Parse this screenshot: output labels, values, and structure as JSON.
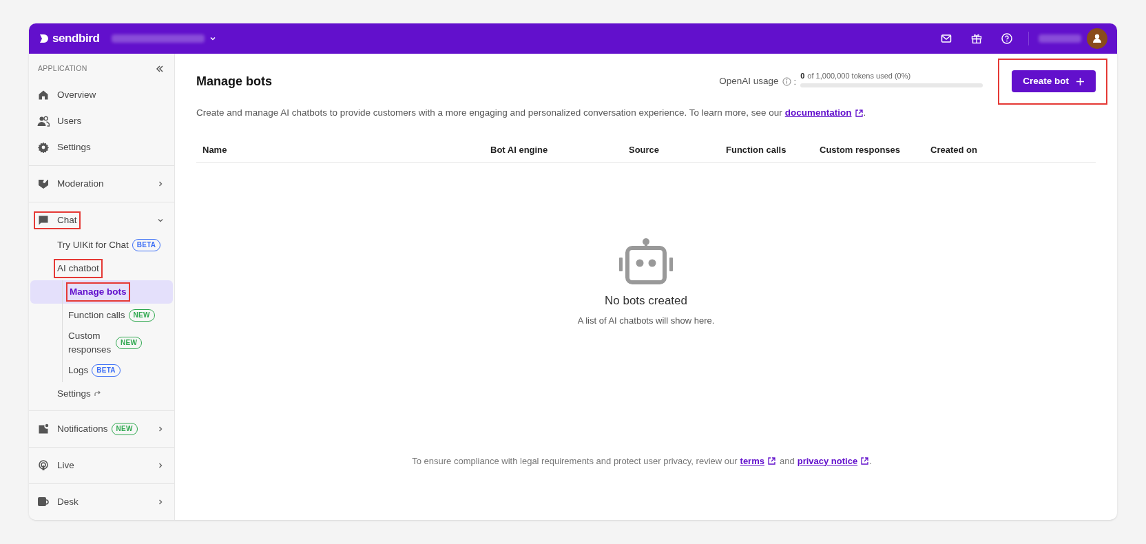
{
  "topbar": {
    "logo": "sendbird"
  },
  "sidebar": {
    "heading": "APPLICATION",
    "groups": [
      [
        {
          "label": "Overview",
          "selected": false,
          "annotated": false
        },
        {
          "label": "Users",
          "selected": false,
          "annotated": false
        },
        {
          "label": "Settings",
          "selected": false,
          "annotated": false
        }
      ],
      [
        {
          "label": "Moderation",
          "selected": false,
          "annotated": false,
          "expanded": false
        }
      ],
      [
        {
          "label": "Chat",
          "selected": false,
          "annotated": true,
          "expanded": true,
          "children": [
            {
              "label": "Try UIKit for Chat",
              "selected": false,
              "annotated": false,
              "badge": {
                "text": "BETA",
                "color": "#3b6ef6"
              }
            },
            {
              "label": "AI chatbot",
              "selected": false,
              "annotated": true,
              "children": [
                {
                  "label": "Manage bots",
                  "selected": true,
                  "annotated": true
                },
                {
                  "label": "Function calls",
                  "selected": false,
                  "annotated": false,
                  "badge": {
                    "text": "NEW",
                    "color": "#2fa84f"
                  }
                },
                {
                  "label": "Custom responses",
                  "selected": false,
                  "annotated": false,
                  "badge": {
                    "text": "NEW",
                    "color": "#2fa84f"
                  }
                },
                {
                  "label": "Logs",
                  "selected": false,
                  "annotated": false,
                  "badge": {
                    "text": "BETA",
                    "color": "#3b6ef6"
                  }
                }
              ]
            },
            {
              "label": "Settings",
              "selected": false,
              "annotated": false,
              "external": true
            }
          ]
        }
      ],
      [
        {
          "label": "Notifications",
          "selected": false,
          "annotated": false,
          "expanded": false,
          "badge": {
            "text": "NEW",
            "color": "#2fa84f"
          }
        }
      ],
      [
        {
          "label": "Live",
          "selected": false,
          "annotated": false,
          "expanded": false
        }
      ],
      [
        {
          "label": "Desk",
          "selected": false,
          "annotated": false,
          "expanded": false
        }
      ]
    ]
  },
  "page": {
    "title": "Manage bots",
    "usage": {
      "label": "OpenAI usage",
      "separator": ":",
      "count": "0",
      "text": "of 1,000,000 tokens used (0%)",
      "level": 0
    },
    "create_button": {
      "label": "Create bot",
      "annotated": true
    },
    "description": "Create and manage AI chatbots to provide customers with a more engaging and personalized conversation experience. To learn more, see our",
    "description_link": "documentation",
    "description_end": ".",
    "table": {
      "columns": [
        "Name",
        "Bot AI engine",
        "Source",
        "Function calls",
        "Custom responses",
        "Created on"
      ]
    },
    "empty_state": {
      "title": "No bots created",
      "subtitle": "A list of AI chatbots will show here."
    },
    "footer": {
      "text": "To ensure compliance with legal requirements and protect user privacy, review our",
      "link1": "terms",
      "middle": "and",
      "link2": "privacy notice",
      "end": "."
    }
  }
}
